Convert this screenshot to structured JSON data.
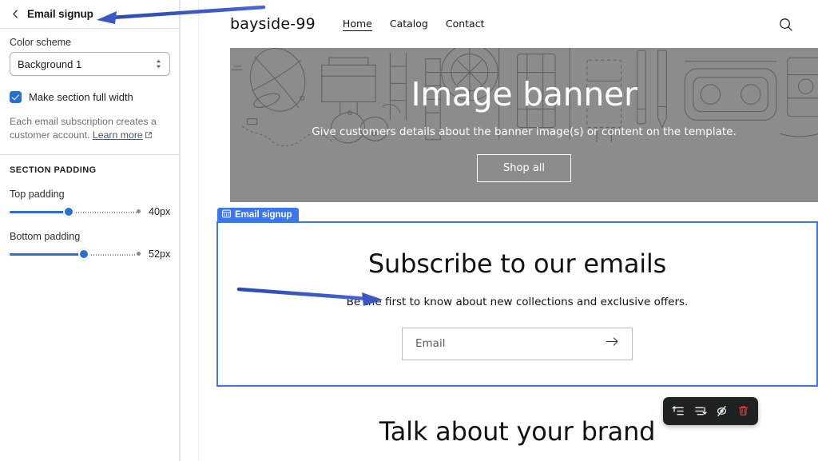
{
  "sidebar": {
    "back_icon": "chevron-left-icon",
    "title": "Email signup",
    "color_scheme": {
      "label": "Color scheme",
      "value": "Background 1",
      "caret_icon": "select-updown-icon"
    },
    "full_width": {
      "label": "Make section full width",
      "checked": true
    },
    "help": {
      "text": "Each email subscription creates a customer account. ",
      "link_label": "Learn more",
      "link_icon": "external-link-icon"
    },
    "section_padding": {
      "heading": "SECTION PADDING",
      "top": {
        "label": "Top padding",
        "value": "40px",
        "percent": 40
      },
      "bottom": {
        "label": "Bottom padding",
        "value": "52px",
        "percent": 52
      }
    }
  },
  "preview": {
    "store": {
      "name": "bayside-99",
      "nav": [
        {
          "label": "Home",
          "active": true
        },
        {
          "label": "Catalog",
          "active": false
        },
        {
          "label": "Contact",
          "active": false
        }
      ],
      "search_icon": "search-icon"
    },
    "banner": {
      "title": "Image banner",
      "subtitle": "Give customers details about the banner image(s) or content on the template.",
      "button_label": "Shop all",
      "background_color": "#8c8c8c"
    },
    "selected_section": {
      "badge_icon": "section-grid-icon",
      "badge_label": "Email signup",
      "border_color": "#3b76ef",
      "title": "Subscribe to our emails",
      "subtitle": "Be the first to know about new collections and exclusive offers.",
      "email_placeholder": "Email",
      "submit_icon": "arrow-right-icon"
    },
    "next_section": {
      "title": "Talk about your brand"
    },
    "toolbar": {
      "buttons": [
        {
          "icon": "move-up-icon",
          "name": "move-section-up"
        },
        {
          "icon": "move-down-icon",
          "name": "move-section-down"
        },
        {
          "icon": "hide-eye-slash-icon",
          "name": "hide-section"
        },
        {
          "icon": "trash-icon",
          "name": "delete-section"
        }
      ],
      "delete_color": "#e0403a",
      "background": "#1f2223"
    }
  },
  "annotations": {
    "arrow_color": "#3b57c4",
    "arrows": [
      {
        "name": "arrow-to-panel-title",
        "direction": "left"
      },
      {
        "name": "arrow-to-subscribe-subtitle",
        "direction": "right"
      }
    ]
  }
}
